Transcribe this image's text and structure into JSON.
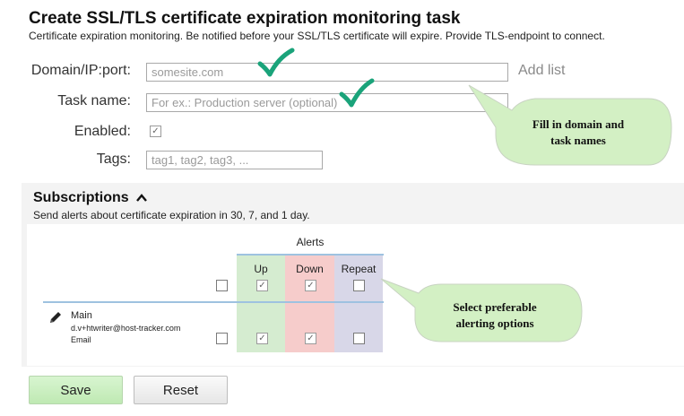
{
  "page": {
    "title": "Create SSL/TLS certificate expiration monitoring task",
    "description": "Certificate expiration monitoring. Be notified before your SSL/TLS certificate will expire. Provide TLS-endpoint to connect."
  },
  "form": {
    "domain_label": "Domain/IP:port:",
    "domain_placeholder": "somesite.com",
    "add_list": "Add list",
    "task_label": "Task name:",
    "task_placeholder": "For ex.: Production server (optional)",
    "enabled_label": "Enabled:",
    "enabled_checked": true,
    "tags_label": "Tags:",
    "tags_placeholder": "tag1, tag2, tag3, ..."
  },
  "subscriptions": {
    "title": "Subscriptions",
    "description": "Send alerts about certificate expiration in 30, 7, and 1 day.",
    "alerts_header": "Alerts",
    "columns": [
      "Up",
      "Down",
      "Repeat"
    ],
    "header_checks": {
      "all": false,
      "up": true,
      "down": true,
      "repeat": false
    },
    "rows": [
      {
        "name": "Main",
        "email": "d.v+htwriter@host-tracker.com",
        "kind": "Email",
        "all": false,
        "up": true,
        "down": true,
        "repeat": false
      }
    ]
  },
  "buttons": {
    "save": "Save",
    "reset": "Reset"
  },
  "callouts": {
    "form_line1": "Fill in domain and",
    "form_line2": "task names",
    "alerts_line1": "Select preferable",
    "alerts_line2": "alerting options"
  },
  "colors": {
    "accent_check": "#1aa37a",
    "callout_fill": "#d3f0c4",
    "up_column": "#d5ecd0",
    "down_column": "#f6cccb",
    "repeat_column": "#d8d7e8",
    "save_button": "#c8efbe"
  },
  "icons": {
    "subscriptions_toggle": "chevron-up-icon",
    "edit": "pencil-icon",
    "annotation": "green-checkmark-icon"
  }
}
